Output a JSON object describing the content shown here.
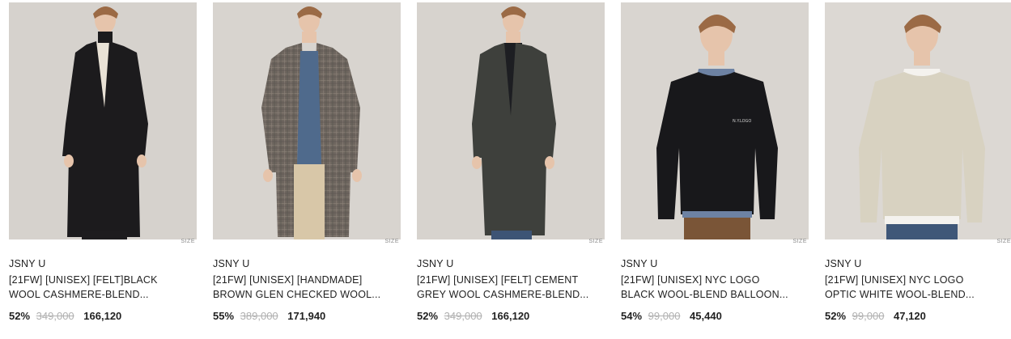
{
  "products": [
    {
      "brand": "JSNY U",
      "name_line1": "[21FW] [UNISEX] [FELT]BLACK",
      "name_line2": "WOOL CASHMERE-BLEND...",
      "discount": "52%",
      "original_price": "349,000",
      "sale_price": "166,120",
      "size_label": "SIZE",
      "colors": {
        "bg": "#d6d2cd",
        "garment": "#1c1b1d",
        "inner": "#e9e2d6",
        "pants": "#1d1c1e"
      }
    },
    {
      "brand": "JSNY U",
      "name_line1": "[21FW] [UNISEX] [HANDMADE]",
      "name_line2": "BROWN GLEN CHECKED WOOL...",
      "discount": "55%",
      "original_price": "389,000",
      "sale_price": "171,940",
      "size_label": "SIZE",
      "colors": {
        "bg": "#d8d4cf",
        "garment": "#6e665f",
        "inner": "#4f6a8c",
        "pants": "#d8c7a8"
      }
    },
    {
      "brand": "JSNY U",
      "name_line1": "[21FW] [UNISEX] [FELT] CEMENT",
      "name_line2": "GREY WOOL CASHMERE-BLEND...",
      "discount": "52%",
      "original_price": "349,000",
      "sale_price": "166,120",
      "size_label": "SIZE",
      "colors": {
        "bg": "#d7d3ce",
        "garment": "#3e403c",
        "inner": "#1d1e22",
        "pants": "#3d5475"
      }
    },
    {
      "brand": "JSNY U",
      "name_line1": "[21FW] [UNISEX] NYC LOGO",
      "name_line2": "BLACK WOOL-BLEND BALLOON...",
      "discount": "54%",
      "original_price": "99,000",
      "sale_price": "45,440",
      "size_label": "SIZE",
      "colors": {
        "bg": "#d9d5d0",
        "garment": "#18181b",
        "inner": "#6d82a3",
        "pants": "#7a5537"
      }
    },
    {
      "brand": "JSNY U",
      "name_line1": "[21FW] [UNISEX] NYC LOGO",
      "name_line2": "OPTIC WHITE WOOL-BLEND...",
      "discount": "52%",
      "original_price": "99,000",
      "sale_price": "47,120",
      "size_label": "SIZE",
      "colors": {
        "bg": "#dcd8d3",
        "garment": "#d8d2c1",
        "inner": "#f4f2ee",
        "pants": "#3f5778"
      }
    }
  ]
}
